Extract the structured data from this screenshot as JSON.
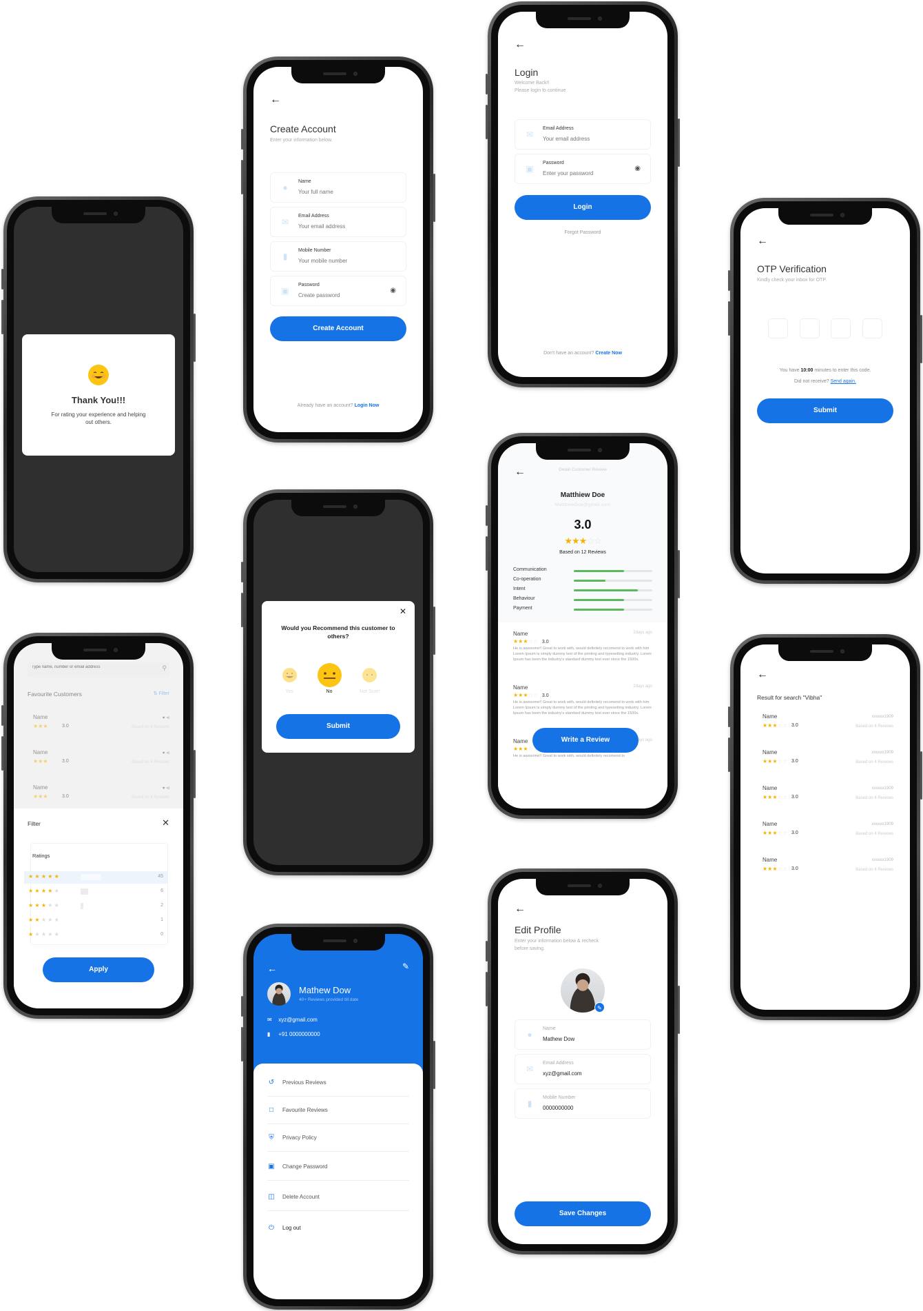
{
  "colors": {
    "primary": "#1673e6",
    "star": "#f5b400",
    "progress": "#5cb85c",
    "emoji": "#fcc514",
    "overlay_dark": "#2f2f2f"
  },
  "thank_you": {
    "title": "Thank You!!!",
    "message": "For rating your experience and helping out others.",
    "emoji_icon": "smiling-face-icon"
  },
  "create_account": {
    "back_icon": "arrow-left-icon",
    "title": "Create Account",
    "subtitle": "Enter your information below.",
    "fields": [
      {
        "label": "Name",
        "placeholder": "Your full name",
        "icon": "user-icon"
      },
      {
        "label": "Email Address",
        "placeholder": "Your email address",
        "icon": "mail-icon"
      },
      {
        "label": "Mobile Number",
        "placeholder": "Your mobile number",
        "icon": "phone-icon"
      },
      {
        "label": "Password",
        "placeholder": "Create password",
        "icon": "lock-icon"
      }
    ],
    "button": "Create Account",
    "footer_text": "Already have an account?",
    "footer_link": "Login Now"
  },
  "login": {
    "title": "Login",
    "subtitle_line1": "Welcome Back!!",
    "subtitle_line2": "Please login to continue",
    "fields": [
      {
        "label": "Email Address",
        "placeholder": "Your email address",
        "icon": "mail-icon"
      },
      {
        "label": "Password",
        "placeholder": "Enter your password",
        "icon": "lock-icon"
      }
    ],
    "button": "Login",
    "forgot": "Forgot Password",
    "footer_text": "Don't have an account?",
    "footer_link": "Create Now"
  },
  "otp": {
    "title": "OTP Verification",
    "subtitle": "Kindly check your inbox for OTP.",
    "digits": [
      "",
      "",
      "",
      ""
    ],
    "timer_prefix": "You have",
    "timer": "10:00",
    "timer_suffix": "minutes to enter this code.",
    "resend_prefix": "Did not receive?",
    "resend_link": "Send again.",
    "button": "Submit"
  },
  "favourites": {
    "search_placeholder": "Type name, number or email address",
    "section_title": "Favourite Customers",
    "filter_label": "Filter",
    "items": [
      {
        "name": "Name",
        "rating": "3.0",
        "stars": 3,
        "based": "Based on 4 Reviews"
      },
      {
        "name": "Name",
        "rating": "3.0",
        "stars": 3,
        "based": "Based on 4 Reviews"
      },
      {
        "name": "Name",
        "rating": "3.0",
        "stars": 3,
        "based": "Based on 4 Reviews"
      }
    ],
    "filter_sheet": {
      "title": "Filter",
      "group_title": "Ratings",
      "rows": [
        {
          "stars": 5,
          "count": "45",
          "share": 1.0
        },
        {
          "stars": 4,
          "count": "6",
          "share": 0.35
        },
        {
          "stars": 3,
          "count": "2",
          "share": 0.12
        },
        {
          "stars": 2,
          "count": "1",
          "share": 0
        },
        {
          "stars": 1,
          "count": "0",
          "share": 0
        }
      ],
      "button": "Apply"
    }
  },
  "recommend": {
    "question": "Would you Recommend this customer to others?",
    "options": [
      {
        "label": "Yes",
        "selected": false
      },
      {
        "label": "No",
        "selected": true
      },
      {
        "label": "Not Sure!",
        "selected": false
      }
    ],
    "button": "Submit"
  },
  "detail_review": {
    "header": "Detail Customer Review",
    "name": "Matthiew Doe",
    "email": "MatthiewDoe@gmail.com",
    "score": "3.0",
    "stars": 3,
    "based_on": "Based on 12 Reviews",
    "metrics": [
      {
        "label": "Communication",
        "value": 0.64
      },
      {
        "label": "Co-operation",
        "value": 0.4
      },
      {
        "label": "Intent",
        "value": 0.82
      },
      {
        "label": "Behaviour",
        "value": 0.64
      },
      {
        "label": "Payment",
        "value": 0.64
      }
    ],
    "reviews": [
      {
        "name": "Name",
        "date": "2days ago",
        "rating": "3.0",
        "text": "He is awesome!! Great to work with, would definitely recomend to work with him Lorem Ipsum is simply dummy text of the printing and typesetting industry. Lorem Ipsum has been the industry's standard dummy text ever since the 1500s."
      },
      {
        "name": "Name",
        "date": "2days ago",
        "rating": "3.0",
        "text": "He is awesome!! Great to work with, would definitely recomend to work with him Lorem Ipsum is simply dummy text of the printing and typesetting industry. Lorem Ipsum has been the industry's standard dummy text ever since the 1500s."
      },
      {
        "name": "Name",
        "date": "2days ago",
        "rating": "3.0",
        "text": "He is awesome!! Great to work with, would definitely recomend to"
      }
    ],
    "button": "Write a Review"
  },
  "search_result": {
    "title": "Result for search \"Vibha\"",
    "items": [
      {
        "name": "Name",
        "rating": "3.0",
        "id": "xxxxxx1909",
        "based": "Based on 4 Reviews"
      },
      {
        "name": "Name",
        "rating": "3.0",
        "id": "xxxxxx1909",
        "based": "Based on 4 Reviews"
      },
      {
        "name": "Name",
        "rating": "3.0",
        "id": "xxxxxx1909",
        "based": "Based on 4 Reviews"
      },
      {
        "name": "Name",
        "rating": "3.0",
        "id": "xxxxxx1909",
        "based": "Based on 4 Reviews"
      },
      {
        "name": "Name",
        "rating": "3.0",
        "id": "xxxxxx1909",
        "based": "Based on 4 Reviews"
      }
    ]
  },
  "profile": {
    "name": "Mathew Dow",
    "subtitle": "40+ Reviews provided till date",
    "email": "xyz@gmail.com",
    "phone": "+91 0000000000",
    "menu": [
      {
        "label": "Previous Reviews",
        "icon": "history-icon"
      },
      {
        "label": "Favourite Reviews",
        "icon": "bookmark-icon"
      },
      {
        "label": "Privacy Policy",
        "icon": "shield-icon"
      },
      {
        "label": "Change Password",
        "icon": "lock-icon"
      },
      {
        "label": "Delete Account",
        "icon": "trash-icon"
      },
      {
        "label": "Log out",
        "icon": "power-icon"
      }
    ]
  },
  "edit_profile": {
    "title": "Edit Profile",
    "subtitle": "Enter your information below & recheck before saving.",
    "fields": [
      {
        "label": "Name",
        "value": "Mathew Dow",
        "icon": "user-icon"
      },
      {
        "label": "Email Address",
        "value": "xyz@gmail.com",
        "icon": "mail-icon"
      },
      {
        "label": "Mobile Number",
        "value": "0000000000",
        "icon": "phone-icon"
      }
    ],
    "button": "Save Changes"
  }
}
